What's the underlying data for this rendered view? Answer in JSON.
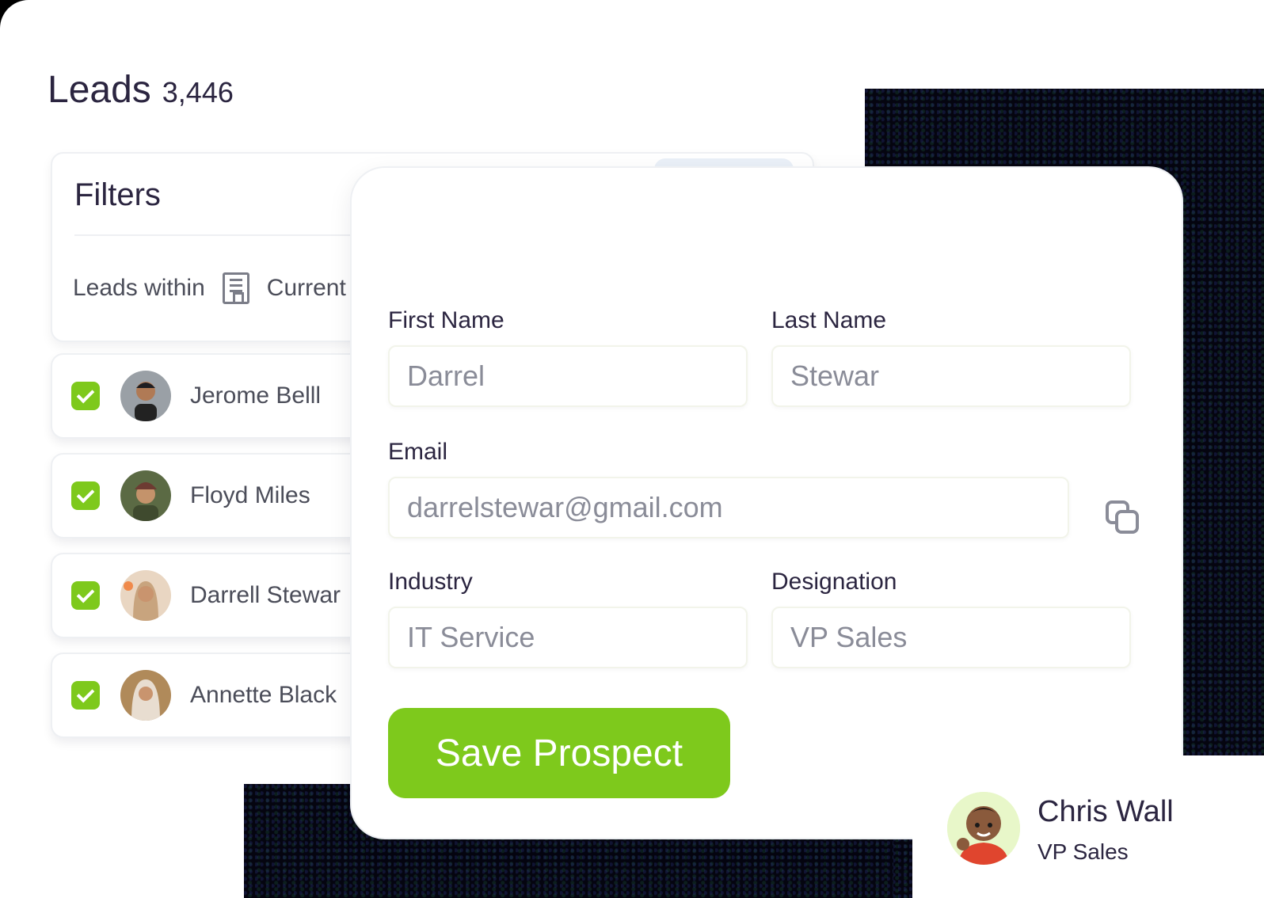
{
  "header": {
    "title": "Leads",
    "count": "3,446"
  },
  "filters": {
    "title": "Filters",
    "within_label": "Leads within",
    "within_value": "Current"
  },
  "leads": [
    {
      "name": "Jerome Belll",
      "checked": true
    },
    {
      "name": "Floyd Miles",
      "checked": true
    },
    {
      "name": "Darrell Stewar",
      "checked": true
    },
    {
      "name": "Annette Black",
      "checked": true
    }
  ],
  "form": {
    "first_name_label": "First Name",
    "first_name_value": "Darrel",
    "last_name_label": "Last Name",
    "last_name_value": "Stewar",
    "email_label": "Email",
    "email_value": "darrelstewar@gmail.com",
    "industry_label": "Industry",
    "industry_value": "IT Service",
    "designation_label": "Designation",
    "designation_value": "VP Sales",
    "save_label": "Save Prospect"
  },
  "profile": {
    "name": "Chris Wall",
    "role": "VP Sales"
  },
  "colors": {
    "accent": "#7ec91c",
    "text": "#2b2540",
    "muted": "#8a8c98"
  },
  "icons": [
    "building-icon",
    "check-icon",
    "copy-icon"
  ]
}
